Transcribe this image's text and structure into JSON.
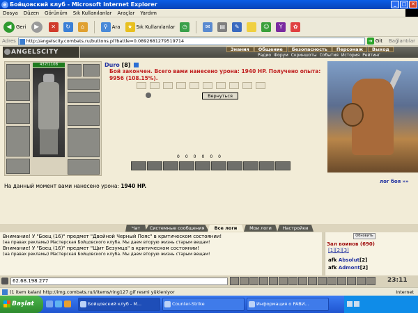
{
  "window": {
    "title": "Бойцовский клуб - Microsoft Internet Explorer",
    "minimize": "_",
    "maximize": "□",
    "close": "✕"
  },
  "menu": [
    "Dosya",
    "Düzen",
    "Görünüm",
    "Sık Kullanılanlar",
    "Araçlar",
    "Yardım"
  ],
  "toolbar": {
    "back": "Geri",
    "search": "Ara",
    "favorites": "Sık Kullanılanlar"
  },
  "address": {
    "label": "Adres",
    "url": "http://angelscity.combats.ru/buttons.pl?battle=0.0892681279519714",
    "go": "Git",
    "links": "Bağlantılar"
  },
  "site": {
    "logo": "ANGELSCITY",
    "top_nav": [
      "Знания",
      "Общение",
      "Безопасность",
      "Персонаж",
      "Выход"
    ],
    "sub_nav": [
      "Радио",
      "Форум",
      "Скриншоты",
      "События",
      "История",
      "Рейтинг"
    ]
  },
  "character": {
    "hp": "437/1108",
    "name": "Duro",
    "level": "[8]"
  },
  "battle": {
    "message": "Бой закончен. Всего вами нанесено урона: 1940 HP. Получено опыта: 9956 (108.15%).",
    "return_button": "Вернуться",
    "counts": [
      "0",
      "0",
      "0",
      "0",
      "0",
      "0"
    ],
    "log_link": "лог боя »»",
    "damage_label": "На данный момент вами нанесено урона:",
    "damage_value": "1940 HP."
  },
  "chat": {
    "tabs": [
      "Чат",
      "Системные сообщения",
      "Все логи",
      "Мои логи",
      "Настройки"
    ],
    "lines": [
      {
        "text": "Внимание! У \"Боец (16)\" предмет \"Двойной Черный Пояс\" в критическом состоянии!",
        "small": false
      },
      {
        "text": "(на правах рекламы) Мастерская Бойцовского клуба. Мы даем вторую жизнь старым вещам!",
        "small": true
      },
      {
        "text": "Внимание! У \"Боец (16)\" предмет \"Щит Безумца\" в критическом состоянии!",
        "small": false
      },
      {
        "text": "(на правах рекламы) Мастерская Бойцовского клуба. Мы даем вторую жизнь старым вещам!",
        "small": true
      }
    ]
  },
  "roster": {
    "update_button": "Обновить",
    "hall": "Зал воинов (690)",
    "pages": [
      "[1]",
      "[2]",
      "[3]"
    ],
    "players": [
      {
        "status": "afk",
        "name": "Absolut",
        "level": "[2]"
      },
      {
        "status": "afk",
        "name": "Admont",
        "level": "[2]"
      }
    ]
  },
  "input": {
    "ip": "62.68.198.277",
    "clock": "23:11"
  },
  "status": {
    "text": "(1 item kalan) http://img.combats.ru/i/items/ring127.gif resmi yükleniyor",
    "zone": "Internet"
  },
  "taskbar": {
    "start": "Başlat",
    "tasks": [
      "Бойцовский клуб - M...",
      "Counter-Strike",
      "Информация о PAВИ..."
    ]
  }
}
